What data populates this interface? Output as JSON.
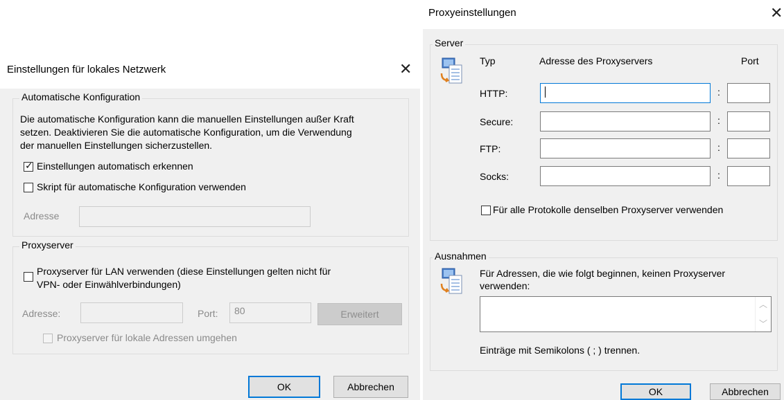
{
  "lan_dialog": {
    "title": "Einstellungen für lokales Netzwerk",
    "auto_config": {
      "legend": "Automatische Konfiguration",
      "description_line1": "Die automatische Konfiguration kann die manuellen Einstellungen außer Kraft",
      "description_line2": "setzen. Deaktivieren Sie die automatische Konfiguration, um die Verwendung",
      "description_line3": "der manuellen Einstellungen sicherzustellen.",
      "auto_detect_label": "Einstellungen automatisch erkennen",
      "auto_detect_checked": true,
      "script_label": "Skript für automatische Konfiguration verwenden",
      "script_checked": false,
      "address_label": "Adresse",
      "address_value": ""
    },
    "proxy": {
      "legend": "Proxyserver",
      "use_proxy_line1": "Proxyserver für LAN verwenden (diese Einstellungen gelten nicht für",
      "use_proxy_line2": "VPN- oder Einwählverbindungen)",
      "use_proxy_checked": false,
      "address_label": "Adresse:",
      "address_value": "",
      "port_label": "Port:",
      "port_value": "80",
      "advanced_button": "Erweitert",
      "bypass_label": "Proxyserver für lokale Adressen umgehen",
      "bypass_checked": false
    },
    "ok_button": "OK",
    "cancel_button": "Abbrechen"
  },
  "proxy_dialog": {
    "title": "Proxyeinstellungen",
    "server": {
      "legend": "Server",
      "col_type": "Typ",
      "col_address": "Adresse des Proxyservers",
      "col_port": "Port",
      "rows": [
        {
          "label": "HTTP:",
          "address": "",
          "port": ""
        },
        {
          "label": "Secure:",
          "address": "",
          "port": ""
        },
        {
          "label": "FTP:",
          "address": "",
          "port": ""
        },
        {
          "label": "Socks:",
          "address": "",
          "port": ""
        }
      ],
      "colon": ":",
      "same_proxy_label": "Für alle Protokolle denselben Proxyserver verwenden",
      "same_proxy_checked": false
    },
    "exceptions": {
      "legend": "Ausnahmen",
      "description_line1": "Für Adressen, die wie folgt beginnen, keinen Proxyserver",
      "description_line2": "verwenden:",
      "value": "",
      "hint": "Einträge mit Semikolons ( ; ) trennen."
    },
    "ok_button": "OK",
    "cancel_button": "Abbrechen"
  },
  "icons": {
    "close": "close-icon",
    "network": "network-settings-icon",
    "scroll_up": "chevron-up-icon",
    "scroll_down": "chevron-down-icon"
  }
}
